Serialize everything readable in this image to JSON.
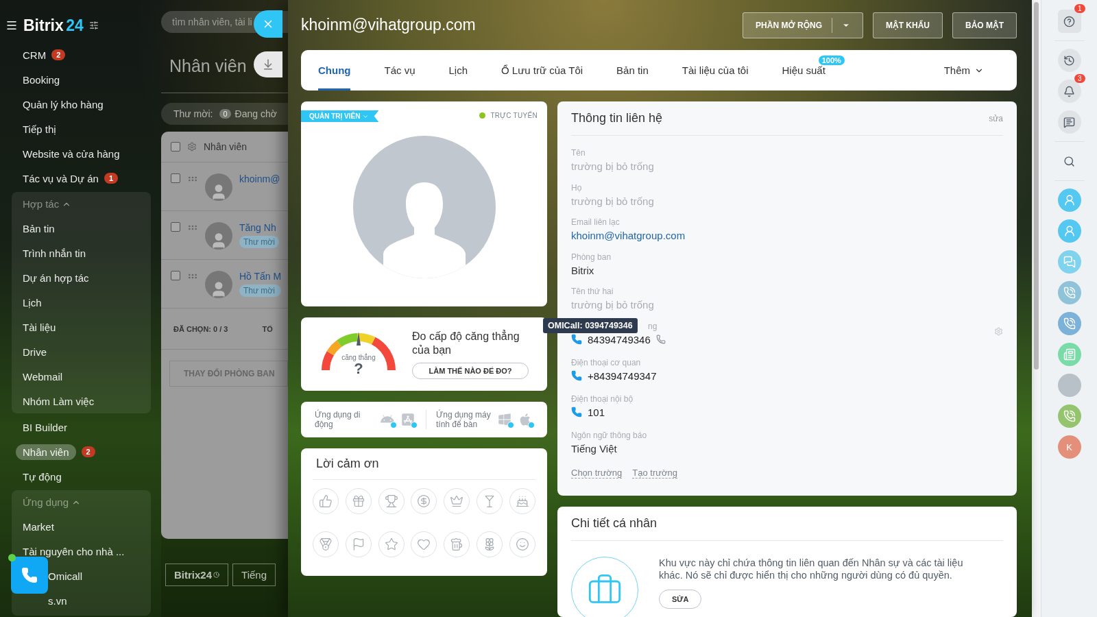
{
  "sidebar": {
    "logo": {
      "name": "Bitrix",
      "number": "24"
    },
    "items": [
      {
        "label": "CRM",
        "counter": "2",
        "selected": false
      },
      {
        "label": "Booking",
        "selected": false
      },
      {
        "label": "Quản lý kho hàng",
        "selected": false
      },
      {
        "label": "Tiếp thị",
        "selected": false
      },
      {
        "label": "Website và cửa hàng",
        "selected": false
      },
      {
        "label": "Tác vụ và Dự án",
        "counter": "1",
        "selected": false
      },
      {
        "label": "Hợp tác",
        "kind": "group",
        "expanded": true,
        "children": [
          {
            "label": "Bản tin",
            "selected": false
          },
          {
            "label": "Trình nhắn tin",
            "selected": false
          },
          {
            "label": "Dự án hợp tác",
            "selected": false
          },
          {
            "label": "Lịch",
            "selected": false
          },
          {
            "label": "Tài liệu",
            "selected": false
          },
          {
            "label": "Drive",
            "selected": false
          },
          {
            "label": "Webmail",
            "selected": false
          },
          {
            "label": "Nhóm Làm việc",
            "selected": false
          }
        ]
      },
      {
        "label": "BI Builder",
        "selected": false
      },
      {
        "label": "Nhân viên",
        "counter": "2",
        "selected": true
      },
      {
        "label": "Tự động",
        "selected": false
      },
      {
        "label": "Ứng dụng",
        "kind": "group",
        "expanded": true,
        "children": [
          {
            "label": "Market",
            "selected": false
          },
          {
            "label": "Tài nguyên cho nhà ...",
            "selected": false
          },
          {
            "label": "Omicall",
            "selected": false,
            "covered": true
          },
          {
            "label": "s.vn",
            "selected": false,
            "covered": true
          }
        ]
      }
    ]
  },
  "background_page": {
    "search": {
      "placeholder": "tìm nhân viên, tài li"
    },
    "title": "Nhân viên",
    "filter": {
      "label": "Thư mời:",
      "count": "0",
      "status": "Đang chờ"
    },
    "table": {
      "column": "Nhân viên",
      "checked": false,
      "rows": [
        {
          "name": "khoinm@",
          "checked": false
        },
        {
          "name": "Tăng Nh",
          "badge": "Thư mời",
          "checked": false
        },
        {
          "name": "Hồ Tấn M",
          "badge": "Thư mời",
          "checked": false
        }
      ],
      "selected_label": "ĐÃ CHỌN:",
      "selected_count": "0 / 3",
      "total_label": "TỔ"
    },
    "action_button": "THAY ĐỔI PHÒNG BAN",
    "footer": [
      "Bitrix24",
      "Tiếng"
    ]
  },
  "slider": {
    "title": "khoinm@vihatgroup.com",
    "buttons": [
      {
        "label": "PHẦN MỞ RỘNG",
        "kind": "split"
      },
      {
        "label": "MẬT KHẨU",
        "kind": "plain"
      },
      {
        "label": "BẢO MẬT",
        "kind": "plain"
      }
    ],
    "tabs": [
      {
        "label": "Chung",
        "selected": true
      },
      {
        "label": "Tác vụ",
        "selected": false
      },
      {
        "label": "Lịch",
        "selected": false
      },
      {
        "label": "Ổ Lưu trữ của Tôi",
        "selected": false
      },
      {
        "label": "Bản tin",
        "selected": false
      },
      {
        "label": "Tài liệu của tôi",
        "selected": false
      },
      {
        "label": "Hiệu suất",
        "selected": false,
        "badge": "100%"
      },
      {
        "label": "Thêm",
        "selected": false,
        "kind": "more"
      }
    ],
    "profile": {
      "role": "QUẢN TRỊ VIÊN",
      "status": "TRỰC TUYẾN",
      "online": true
    },
    "stress": {
      "gauge_label": "căng thẳng",
      "value": "?",
      "title": "Đo cấp độ căng thẳng của bạn",
      "button": "LÀM THẾ NÀO ĐỂ ĐO?"
    },
    "apps": [
      {
        "label": "Ứng dụng di động",
        "platforms": [
          {
            "kind": "android"
          },
          {
            "kind": "ios"
          }
        ]
      },
      {
        "label": "Ứng dụng máy tính để bàn",
        "platforms": [
          {
            "kind": "windows"
          },
          {
            "kind": "mac"
          }
        ]
      }
    ],
    "thanks": {
      "title": "Lời cảm ơn",
      "badges": [
        {
          "kind": "like"
        },
        {
          "kind": "gift"
        },
        {
          "kind": "cup"
        },
        {
          "kind": "money"
        },
        {
          "kind": "crown"
        },
        {
          "kind": "drink"
        },
        {
          "kind": "cake"
        },
        {
          "kind": "medal"
        },
        {
          "kind": "flag"
        },
        {
          "kind": "star"
        },
        {
          "kind": "heart"
        },
        {
          "kind": "beer"
        },
        {
          "kind": "flower"
        },
        {
          "kind": "smile"
        }
      ]
    },
    "contact": {
      "title": "Thông tin liên hệ",
      "edit": "sửa",
      "fields": [
        {
          "label": "Tên",
          "value": "trường bị bỏ trống",
          "kind": "empty"
        },
        {
          "label": "Họ",
          "value": "trường bị bỏ trống",
          "kind": "empty"
        },
        {
          "label": "Email liên lạc",
          "value": "khoinm@vihatgroup.com",
          "kind": "link"
        },
        {
          "label": "Phòng ban",
          "value": "Bitrix",
          "kind": "text"
        },
        {
          "label": "Tên thứ hai",
          "value": "trường bị bỏ trống",
          "kind": "empty"
        },
        {
          "label": "ng",
          "value": "84394749346",
          "kind": "phone",
          "tooltip": "OMICall: 0394749346",
          "call_button": true,
          "settings": true
        },
        {
          "label": "Điện thoại cơ quan",
          "value": "+84394749347",
          "kind": "phone"
        },
        {
          "label": "Điện thoại nội bộ",
          "value": "101",
          "kind": "phone"
        },
        {
          "label": "Ngôn ngữ thông báo",
          "value": "Tiếng Việt",
          "kind": "text"
        }
      ],
      "links": [
        "Chọn trường",
        "Tạo trường"
      ]
    },
    "personal": {
      "title": "Chi tiết cá nhân",
      "text": "Khu vực này chỉ chứa thông tin liên quan đến Nhân sự và các tài liệu khác. Nó sẽ chỉ được hiển thị cho những người dùng có đủ quyền.",
      "button": "SỬA"
    }
  },
  "rail": {
    "groups": [
      [
        {
          "kind": "help",
          "badge": "1"
        }
      ],
      [
        {
          "kind": "history"
        },
        {
          "kind": "bell",
          "badge": "3"
        },
        {
          "kind": "chat-search"
        }
      ],
      [
        {
          "kind": "search"
        }
      ],
      [
        {
          "kind": "contact",
          "color": "#55c8f2"
        },
        {
          "kind": "contact",
          "color": "#55c8f2"
        },
        {
          "kind": "chat",
          "color": "#7fd3ec"
        },
        {
          "kind": "phone",
          "color": "#8fc3d9"
        },
        {
          "kind": "phone",
          "color": "#7cb1d8"
        },
        {
          "kind": "news",
          "color": "#78dba8"
        },
        {
          "kind": "photo",
          "color": "#b8c0c8"
        },
        {
          "kind": "phone",
          "color": "#95c46e"
        },
        {
          "kind": "letter",
          "text": "K",
          "color": "#e38f7a"
        }
      ]
    ]
  }
}
